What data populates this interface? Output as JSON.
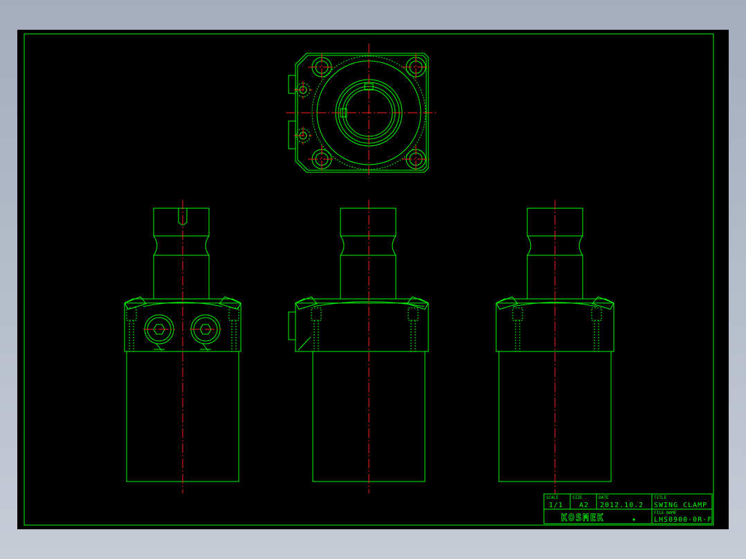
{
  "title_block": {
    "scale_label": "SCALE",
    "scale": "1/1",
    "size_label": "SIZE",
    "size": "A2",
    "date_label": "DATE",
    "date": "2012.10.2",
    "title_label": "TITLE",
    "title": "SWING CLAMP",
    "file_name_label": "FILE NAME",
    "file_name": "LHS0900-0R-F",
    "brand": "KOSMEK"
  },
  "colors": {
    "background": "#000000",
    "line": "#00ff00",
    "centerline": "#ff2020",
    "window": "#a3adbd"
  }
}
